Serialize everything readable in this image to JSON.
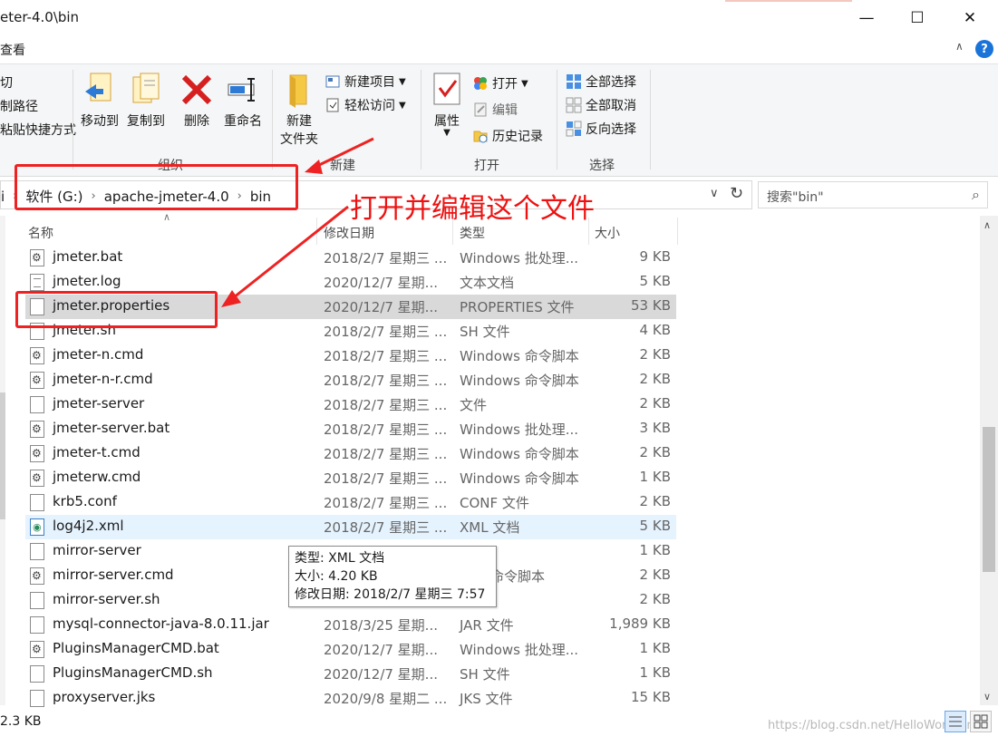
{
  "window": {
    "title": "eter-4.0\\bin",
    "minimize_icon": "minimize-icon",
    "maximize_icon": "maximize-icon",
    "close_icon": "close-icon"
  },
  "ribbon_tabs": {
    "view": "查看"
  },
  "ribbon": {
    "clipboard_partial": {
      "cut": "切",
      "copy_path": "制路径",
      "paste_shortcut": "粘贴快捷方式"
    },
    "organize": {
      "group_label": "组织",
      "move_to": "移动到",
      "copy_to": "复制到",
      "delete": "删除",
      "rename": "重命名"
    },
    "new": {
      "group_label": "新建",
      "new_folder_line1": "新建",
      "new_folder_line2": "文件夹",
      "new_item": "新建项目",
      "easy_access": "轻松访问"
    },
    "open": {
      "group_label": "打开",
      "properties": "属性",
      "open": "打开",
      "edit": "编辑",
      "history": "历史记录"
    },
    "select": {
      "group_label": "选择",
      "select_all": "全部选择",
      "select_none": "全部取消",
      "invert": "反向选择"
    }
  },
  "address": {
    "partial_prefix": "i",
    "crumbs": [
      "软件 (G:)",
      "apache-jmeter-4.0",
      "bin"
    ],
    "search_placeholder": "搜索\"bin\""
  },
  "columns": {
    "name": "名称",
    "date": "修改日期",
    "type": "类型",
    "size": "大小"
  },
  "files": [
    {
      "name": "jmeter.bat",
      "date": "2018/2/7 星期三 ...",
      "type": "Windows 批处理...",
      "size": "9 KB",
      "icon": "gear"
    },
    {
      "name": "jmeter.log",
      "date": "2020/12/7 星期...",
      "type": "文本文档",
      "size": "5 KB",
      "icon": "text"
    },
    {
      "name": "jmeter.properties",
      "date": "2020/12/7 星期...",
      "type": "PROPERTIES 文件",
      "size": "53 KB",
      "icon": "blank"
    },
    {
      "name": "jmeter.sh",
      "date": "2018/2/7 星期三 ...",
      "type": "SH 文件",
      "size": "4 KB",
      "icon": "blank"
    },
    {
      "name": "jmeter-n.cmd",
      "date": "2018/2/7 星期三 ...",
      "type": "Windows 命令脚本",
      "size": "2 KB",
      "icon": "gear"
    },
    {
      "name": "jmeter-n-r.cmd",
      "date": "2018/2/7 星期三 ...",
      "type": "Windows 命令脚本",
      "size": "2 KB",
      "icon": "gear"
    },
    {
      "name": "jmeter-server",
      "date": "2018/2/7 星期三 ...",
      "type": "文件",
      "size": "2 KB",
      "icon": "blank"
    },
    {
      "name": "jmeter-server.bat",
      "date": "2018/2/7 星期三 ...",
      "type": "Windows 批处理...",
      "size": "3 KB",
      "icon": "gear"
    },
    {
      "name": "jmeter-t.cmd",
      "date": "2018/2/7 星期三 ...",
      "type": "Windows 命令脚本",
      "size": "2 KB",
      "icon": "gear"
    },
    {
      "name": "jmeterw.cmd",
      "date": "2018/2/7 星期三 ...",
      "type": "Windows 命令脚本",
      "size": "1 KB",
      "icon": "gear"
    },
    {
      "name": "krb5.conf",
      "date": "2018/2/7 星期三 ...",
      "type": "CONF 文件",
      "size": "2 KB",
      "icon": "blank"
    },
    {
      "name": "log4j2.xml",
      "date": "2018/2/7 星期三 ...",
      "type": "XML 文档",
      "size": "5 KB",
      "icon": "xml"
    },
    {
      "name": "mirror-server",
      "date": "",
      "type": "",
      "size": "1 KB",
      "icon": "blank"
    },
    {
      "name": "mirror-server.cmd",
      "date": "",
      "type": "ows 命令脚本",
      "size": "2 KB",
      "icon": "gear"
    },
    {
      "name": "mirror-server.sh",
      "date": "",
      "type": "件",
      "size": "2 KB",
      "icon": "blank"
    },
    {
      "name": "mysql-connector-java-8.0.11.jar",
      "date": "2018/3/25 星期...",
      "type": "JAR 文件",
      "size": "1,989 KB",
      "icon": "blank"
    },
    {
      "name": "PluginsManagerCMD.bat",
      "date": "2020/12/7 星期...",
      "type": "Windows 批处理...",
      "size": "1 KB",
      "icon": "gear"
    },
    {
      "name": "PluginsManagerCMD.sh",
      "date": "2020/12/7 星期...",
      "type": "SH 文件",
      "size": "1 KB",
      "icon": "blank"
    },
    {
      "name": "proxyserver.jks",
      "date": "2020/9/8 星期二 ...",
      "type": "JKS 文件",
      "size": "15 KB",
      "icon": "blank"
    }
  ],
  "selected_index": 2,
  "hover_index": 11,
  "tooltip": {
    "type": "类型: XML 文档",
    "size": "大小: 4.20 KB",
    "date": "修改日期: 2018/2/7 星期三 7:57"
  },
  "status": {
    "selection_size": "2.3 KB"
  },
  "annotation": {
    "text": "打开并编辑这个文件",
    "color": "#ee1111"
  },
  "watermark": "https://blog.csdn.net/HelloWorld_ing",
  "colors": {
    "accent_blue": "#1a73d9",
    "selected_row": "#d9d9d9",
    "hover_row": "#e5f3ff",
    "annotation_red": "#ee2222"
  }
}
